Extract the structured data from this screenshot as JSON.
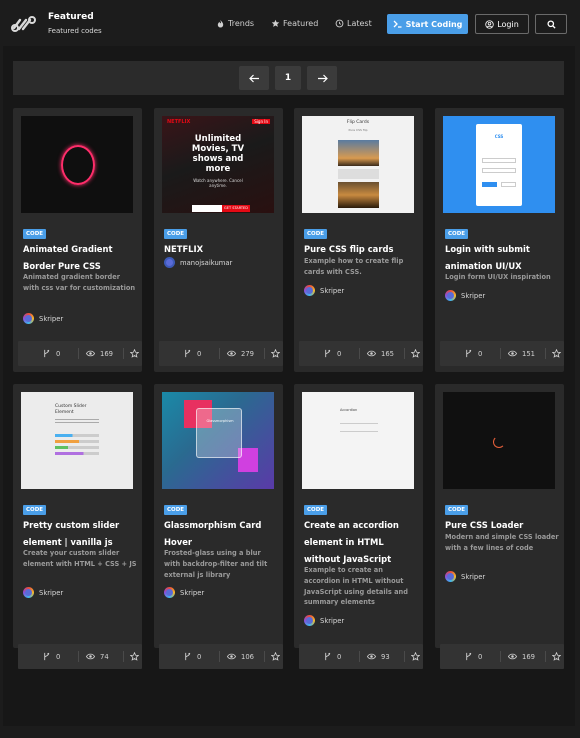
{
  "header": {
    "brand_title": "Featured",
    "brand_subtitle": "Featured codes",
    "nav": [
      {
        "label": "Trends",
        "icon": "fire-icon"
      },
      {
        "label": "Featured",
        "icon": "star-icon"
      },
      {
        "label": "Latest",
        "icon": "clock-icon"
      }
    ],
    "start_coding": "Start Coding",
    "login": "Login"
  },
  "pagination": {
    "page": "1"
  },
  "cards": [
    {
      "badge": "CODE",
      "title": "Animated Gradient Border Pure CSS",
      "desc": "Animated gradient border with css var for customization",
      "author": "Skriper",
      "forks": "0",
      "views": "169"
    },
    {
      "badge": "CODE",
      "title": "NETFLIX",
      "desc": "",
      "author": "manojsaikumar",
      "forks": "0",
      "views": "279"
    },
    {
      "badge": "CODE",
      "title": "Pure CSS flip cards",
      "desc": "Example how to create flip cards with CSS.",
      "author": "Skriper",
      "forks": "0",
      "views": "165"
    },
    {
      "badge": "CODE",
      "title": "Login with submit animation UI/UX",
      "desc": "Login form UI/UX inspiration",
      "author": "Skriper",
      "forks": "0",
      "views": "151"
    },
    {
      "badge": "CODE",
      "title": "Pretty custom slider element | vanilla js",
      "desc": "Create your custom slider element with HTML + CSS + JS",
      "author": "Skriper",
      "forks": "0",
      "views": "74"
    },
    {
      "badge": "CODE",
      "title": "Glassmorphism Card Hover",
      "desc": "Frosted-glass using a blur with backdrop-filter and tilt external js library",
      "author": "Skriper",
      "forks": "0",
      "views": "106"
    },
    {
      "badge": "CODE",
      "title": "Create an accordion element in HTML without JavaScript",
      "desc": "Example to create an accordion in HTML without JavaScript using details and summary elements",
      "author": "Skriper",
      "forks": "0",
      "views": "93"
    },
    {
      "badge": "CODE",
      "title": "Pure CSS Loader",
      "desc": "Modern and simple CSS loader with a few lines of code",
      "author": "Skriper",
      "forks": "0",
      "views": "169"
    }
  ],
  "thumbs": {
    "netflix_logo": "NETFLIX",
    "netflix_signin": "Sign In",
    "netflix_headline": "Unlimited Movies, TV shows and more",
    "netflix_sub": "Watch anywhere. Cancel anytime.",
    "netflix_cta": "GET STARTED",
    "flip_title": "Flip Cards",
    "flip_sub": "Pure CSS flip",
    "login_logo": "CSS",
    "slider_title": "Custom Slider Element",
    "accordion_title": "Accordion",
    "glass_title": "Glassmorphism"
  },
  "colors": {
    "accent": "#4a9ee8",
    "card": "#2a2a2a",
    "stats": "#333333",
    "background": "#171717"
  }
}
